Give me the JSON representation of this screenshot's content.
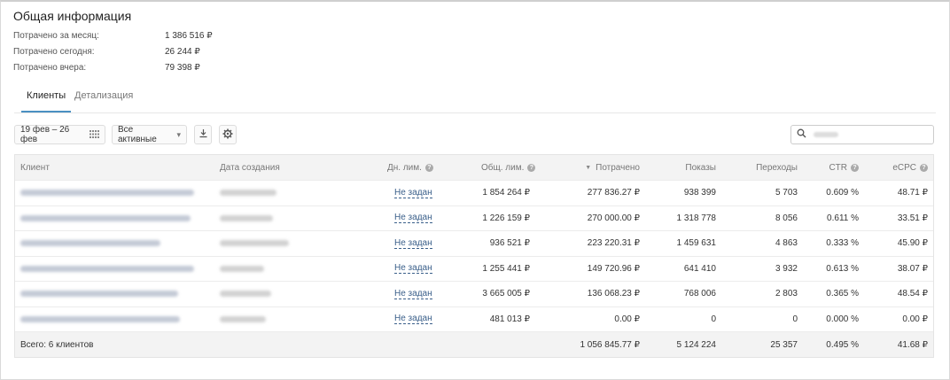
{
  "summary": {
    "title": "Общая информация",
    "stats": [
      {
        "label": "Потрачено за месяц:",
        "value": "1 386 516 ₽"
      },
      {
        "label": "Потрачено сегодня:",
        "value": "26 244 ₽"
      },
      {
        "label": "Потрачено вчера:",
        "value": "79 398 ₽"
      }
    ]
  },
  "tabs": [
    {
      "label": "Клиенты",
      "active": true
    },
    {
      "label": "Детализация",
      "active": false
    }
  ],
  "toolbar": {
    "date_range": "19 фев – 26 фев",
    "filter": "Все активные",
    "download_icon": "download-icon",
    "settings_icon": "gear-icon",
    "search_icon": "search-icon"
  },
  "table": {
    "columns": [
      "Клиент",
      "Дата создания",
      "Дн. лим.",
      "Общ. лим.",
      "Потрачено",
      "Показы",
      "Переходы",
      "CTR",
      "eCPC"
    ],
    "rows": [
      {
        "daily_limit": "Не задан",
        "total_limit": "1 854 264 ₽",
        "spent": "277 836.27 ₽",
        "impressions": "938 399",
        "clicks": "5 703",
        "ctr": "0.609 %",
        "ecpc": "48.71 ₽"
      },
      {
        "daily_limit": "Не задан",
        "total_limit": "1 226 159 ₽",
        "spent": "270 000.00 ₽",
        "impressions": "1 318 778",
        "clicks": "8 056",
        "ctr": "0.611 %",
        "ecpc": "33.51 ₽"
      },
      {
        "daily_limit": "Не задан",
        "total_limit": "936 521 ₽",
        "spent": "223 220.31 ₽",
        "impressions": "1 459 631",
        "clicks": "4 863",
        "ctr": "0.333 %",
        "ecpc": "45.90 ₽"
      },
      {
        "daily_limit": "Не задан",
        "total_limit": "1 255 441 ₽",
        "spent": "149 720.96 ₽",
        "impressions": "641 410",
        "clicks": "3 932",
        "ctr": "0.613 %",
        "ecpc": "38.07 ₽"
      },
      {
        "daily_limit": "Не задан",
        "total_limit": "3 665 005 ₽",
        "spent": "136 068.23 ₽",
        "impressions": "768 006",
        "clicks": "2 803",
        "ctr": "0.365 %",
        "ecpc": "48.54 ₽"
      },
      {
        "daily_limit": "Не задан",
        "total_limit": "481 013 ₽",
        "spent": "0.00 ₽",
        "impressions": "0",
        "clicks": "0",
        "ctr": "0.000 %",
        "ecpc": "0.00 ₽"
      }
    ],
    "footer": {
      "label": "Всего: 6 клиентов",
      "spent": "1 056 845.77 ₽",
      "impressions": "5 124 224",
      "clicks": "25 357",
      "ctr": "0.495 %",
      "ecpc": "41.68 ₽"
    }
  }
}
